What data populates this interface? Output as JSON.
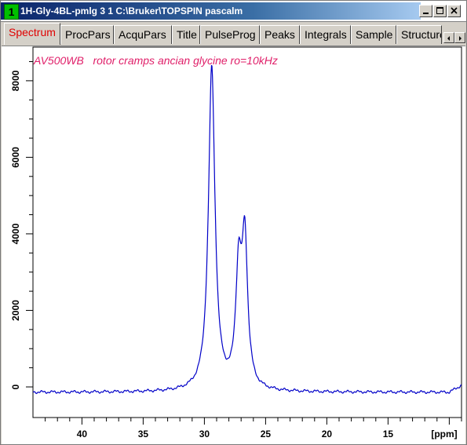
{
  "window": {
    "number": "1",
    "title": "1H-Gly-4BL-pmlg  3  1  C:\\Bruker\\TOPSPIN  pascalm",
    "colors": {
      "title_gradient_start": "#0a246a",
      "number_badge": "#00c000"
    }
  },
  "tabs": [
    {
      "label": "Spectrum",
      "active": true
    },
    {
      "label": "ProcPars",
      "active": false
    },
    {
      "label": "AcquPars",
      "active": false
    },
    {
      "label": "Title",
      "active": false
    },
    {
      "label": "PulseProg",
      "active": false
    },
    {
      "label": "Peaks",
      "active": false
    },
    {
      "label": "Integrals",
      "active": false
    },
    {
      "label": "Sample",
      "active": false
    },
    {
      "label": "Structure",
      "active": false
    }
  ],
  "spectrum": {
    "comment": "AV500WB   rotor cramps ancian glycine ro=10kHz"
  },
  "chart_data": {
    "type": "line",
    "xlabel": "[ppm]",
    "x_reversed": true,
    "xlim": [
      44,
      9
    ],
    "ylim": [
      -800,
      8900
    ],
    "x_ticks": [
      "40",
      "35",
      "30",
      "25",
      "20",
      "15"
    ],
    "y_ticks": [
      "0",
      "2000",
      "4000",
      "6000",
      "8000"
    ],
    "line_color": "#0000c8",
    "baseline": -140,
    "peaks": [
      {
        "center": 29.4,
        "height": 8450,
        "width": 0.32
      },
      {
        "center": 27.2,
        "height": 2950,
        "width": 0.28
      },
      {
        "center": 26.7,
        "height": 3750,
        "width": 0.28
      }
    ]
  }
}
